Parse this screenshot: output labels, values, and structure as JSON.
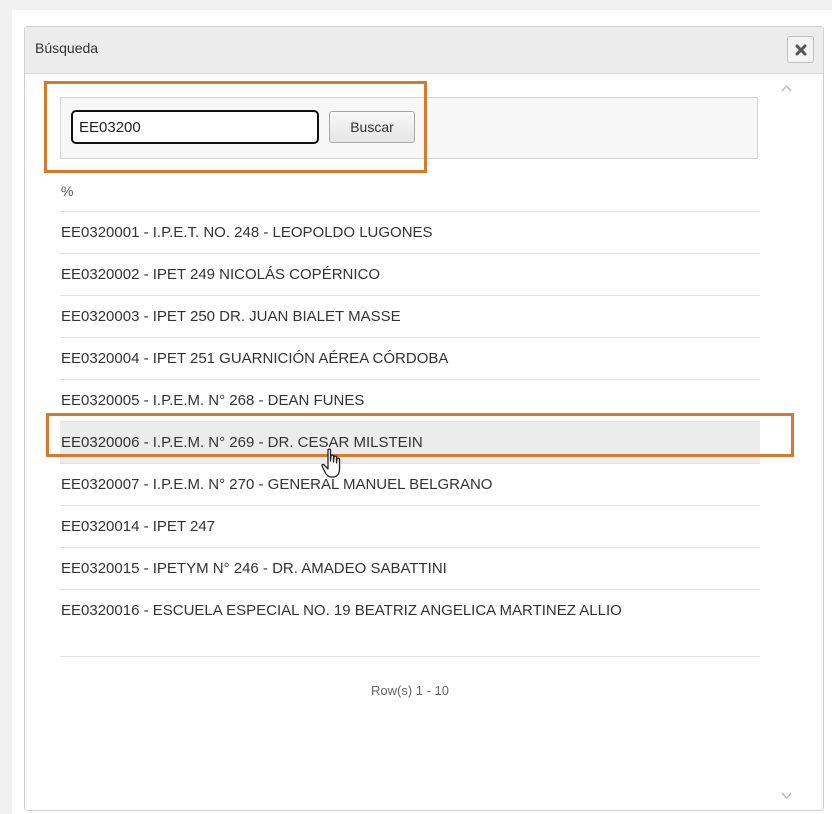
{
  "dialog": {
    "title": "Búsqueda",
    "close_icon": "close-x-icon"
  },
  "search": {
    "value": "EE03200",
    "button_label": "Buscar"
  },
  "results": {
    "items": [
      {
        "label": "%"
      },
      {
        "label": "EE0320001 - I.P.E.T. NO. 248 - LEOPOLDO LUGONES"
      },
      {
        "label": "EE0320002 - IPET 249 NICOLÁS COPÉRNICO"
      },
      {
        "label": "EE0320003 - IPET 250 DR. JUAN BIALET MASSE"
      },
      {
        "label": "EE0320004 - IPET 251 GUARNICIÓN AÉREA CÓRDOBA"
      },
      {
        "label": "EE0320005 - I.P.E.M. N° 268 - DEAN FUNES"
      },
      {
        "label": "EE0320006 - I.P.E.M. N° 269 - DR. CESAR MILSTEIN"
      },
      {
        "label": "EE0320007 - I.P.E.M. N° 270 - GENERAL MANUEL BELGRANO"
      },
      {
        "label": "EE0320014 - IPET 247"
      },
      {
        "label": "EE0320015 - IPETYM N° 246 - DR. AMADEO SABATTINI"
      },
      {
        "label": "EE0320016 - ESCUELA ESPECIAL NO. 19 BEATRIZ ANGELICA MARTINEZ ALLIO"
      }
    ],
    "hovered_index": 6
  },
  "pager": {
    "text": "Row(s) 1 - 10"
  },
  "colors": {
    "highlight": "#d9792c",
    "hover_row": "#ececec",
    "header_bg": "#ececec"
  }
}
